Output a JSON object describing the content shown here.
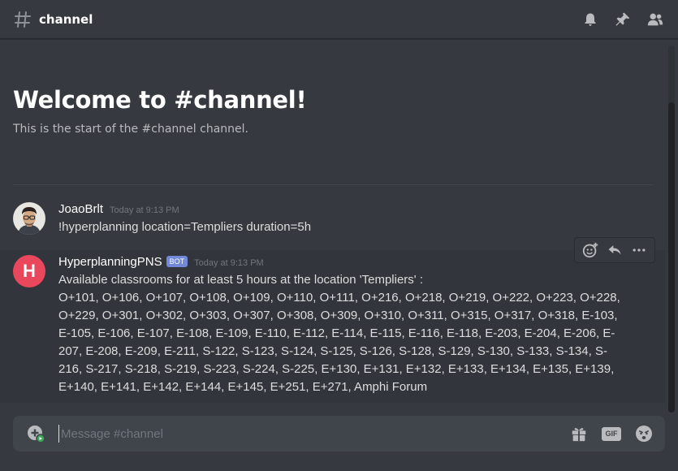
{
  "header": {
    "channel_name": "channel",
    "icons": [
      "hash-icon",
      "bell-icon",
      "pin-icon",
      "members-icon"
    ]
  },
  "welcome": {
    "title": "Welcome to #channel!",
    "subtitle": "This is the start of the #channel channel."
  },
  "messages": [
    {
      "username": "JoaoBrlt",
      "timestamp": "Today at 9:13 PM",
      "content": "!hyperplanning location=Templiers duration=5h"
    },
    {
      "username": "HyperplanningPNS",
      "bot_tag": "BOT",
      "avatar_letter": "H",
      "timestamp": "Today at 9:13 PM",
      "content_line1": "Available classrooms for at least 5 hours at the location 'Templiers' :",
      "content_line2": "O+101, O+106, O+107, O+108, O+109, O+110, O+111, O+216, O+218, O+219, O+222, O+223, O+228, O+229, O+301, O+302, O+303, O+307, O+308, O+309, O+310, O+311, O+315, O+317, O+318, E-103, E-105, E-106, E-107, E-108, E-109, E-110, E-112, E-114, E-115, E-116, E-118, E-203, E-204, E-206, E-207, E-208, E-209, E-211, S-122, S-123, S-124, S-125, S-126, S-128, S-129, S-130, S-133, S-134, S-216, S-217, S-218, S-219, S-223, S-224, S-225, E+130, E+131, E+132, E+133, E+134, E+135, E+139, E+140, E+141, E+142, E+144, E+145, E+251, E+271, Amphi Forum"
    }
  ],
  "message_actions": [
    "add-reaction-icon",
    "reply-icon",
    "more-icon"
  ],
  "composer": {
    "placeholder": "Message #channel",
    "icons": [
      "attach-icon",
      "gift-icon",
      "gif-icon",
      "emoji-icon"
    ],
    "gif_label": "GIF"
  },
  "colors": {
    "background": "#36393f",
    "bot_tag": "#7289da",
    "bot_avatar": "#e9475b"
  }
}
